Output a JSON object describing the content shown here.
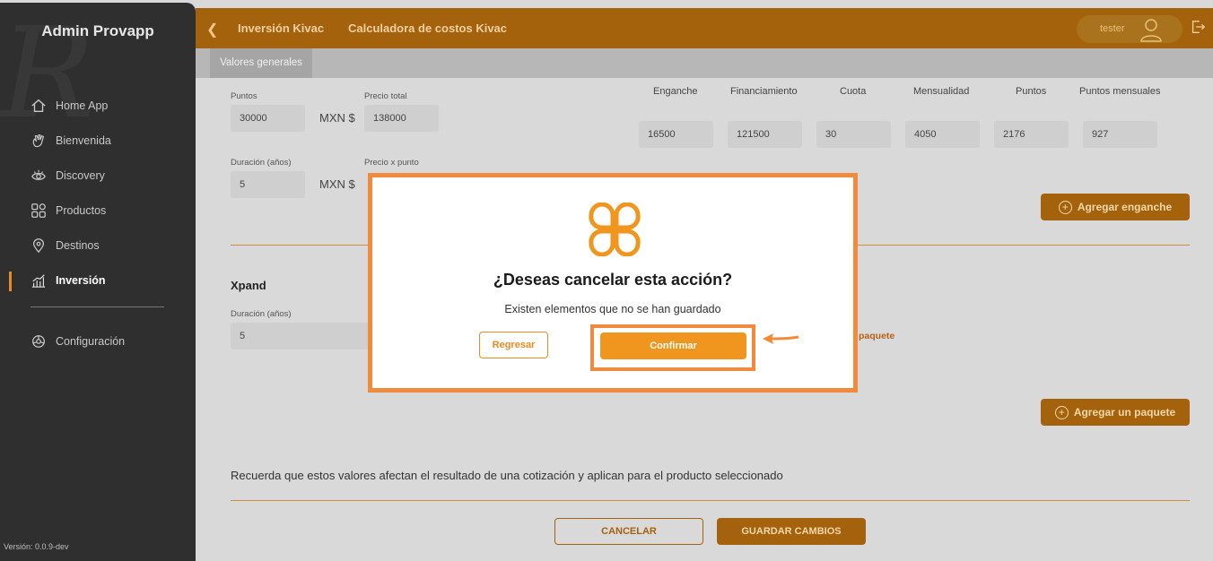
{
  "sidebar": {
    "brand": "Admin Provapp",
    "items": [
      {
        "label": "Home App",
        "icon": "home-icon"
      },
      {
        "label": "Bienvenida",
        "icon": "wave-hand-icon"
      },
      {
        "label": "Discovery",
        "icon": "eye-icon"
      },
      {
        "label": "Productos",
        "icon": "grid-icon"
      },
      {
        "label": "Destinos",
        "icon": "location-pin-icon"
      },
      {
        "label": "Inversión",
        "icon": "bar-chart-icon",
        "active": true
      }
    ],
    "config_label": "Configuración",
    "version": "Versión: 0.0.9-dev"
  },
  "header": {
    "breadcrumb_1": "Inversión Kivac",
    "breadcrumb_2": "Calculadora de costos Kivac",
    "user": "tester"
  },
  "subheader": {
    "tab": "Valores generales"
  },
  "form": {
    "puntos_label": "Puntos",
    "puntos_value": "30000",
    "currency": "MXN $",
    "precio_total_label": "Precio total",
    "precio_total_value": "138000",
    "duracion_label": "Duración (años)",
    "duracion_value": "5",
    "precio_punto_label": "Precio x punto"
  },
  "table": {
    "headers": [
      "Enganche",
      "Financiamiento",
      "Cuota",
      "Mensualidad",
      "Puntos",
      "Puntos mensuales"
    ],
    "values": [
      "16500",
      "121500",
      "30",
      "4050",
      "2176",
      "927"
    ]
  },
  "buttons": {
    "agregar_enganche": "Agregar enganche",
    "agregar_paquete": "Agregar un paquete",
    "cancelar": "CANCELAR",
    "guardar": "GUARDAR CAMBIOS"
  },
  "xpand": {
    "title": "Xpand",
    "duracion_label": "Duración (años)",
    "duracion_value": "5",
    "paquete_link": "paquete"
  },
  "note": "Recuerda que estos valores afectan el resultado de una cotización y aplican para el producto seleccionado",
  "modal": {
    "title": "¿Deseas cancelar esta acción?",
    "message": "Existen elementos que no se han guardado",
    "back": "Regresar",
    "confirm": "Confirmar"
  },
  "colors": {
    "accent": "#f0961e",
    "highlight": "#f08a3c",
    "sidebar_bg": "#2f2f2f",
    "header_bg": "#a5620d"
  }
}
